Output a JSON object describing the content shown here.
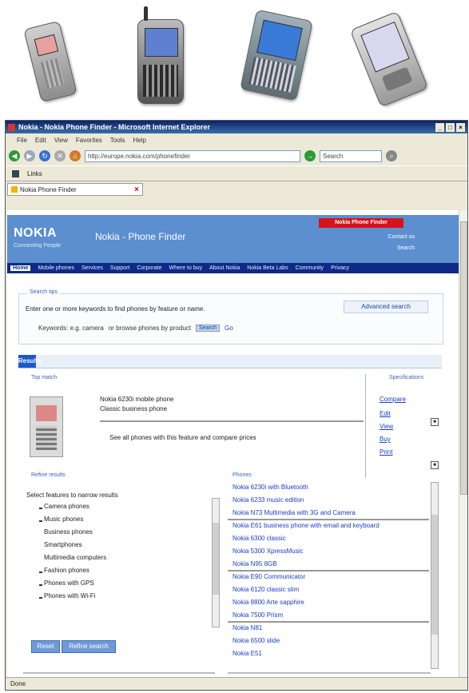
{
  "window": {
    "title": "Nokia - Nokia Phone Finder - Microsoft Internet Explorer",
    "menu": [
      "File",
      "Edit",
      "View",
      "Favorites",
      "Tools",
      "Help"
    ],
    "address": "http://europe.nokia.com/phonefinder",
    "search_placeholder": "Search",
    "links_label": "Links",
    "tab_title": "Nokia Phone Finder",
    "status": "Done"
  },
  "site": {
    "logo": "NOKIA",
    "tagline": "Connecting People",
    "title": "Nokia - Phone Finder",
    "red_link": "Nokia Phone Finder",
    "banner_links": [
      "Contact us",
      "Search"
    ],
    "nav": [
      "Home",
      "Mobile phones",
      "Services",
      "Support",
      "Corporate",
      "Where to buy",
      "About Nokia",
      "Nokia Beta Labs",
      "Community",
      "Privacy"
    ]
  },
  "search_panel": {
    "legend": "Search tips",
    "hint": "Enter one or more keywords to find phones by feature or name.",
    "advanced": "Advanced search",
    "query_label": "Keywords: e.g. camera",
    "query_hint": "or browse phones by product",
    "go": "Search",
    "go2": "Go"
  },
  "results": {
    "tab": "Results",
    "left_title": "Top match",
    "right_title": "Specifications",
    "item_line1": "Nokia 6230i mobile phone",
    "item_line2": "Classic business phone",
    "item_line3": "See all phones with this feature and compare prices",
    "spec_links": [
      "Compare",
      "Edit",
      "View",
      "Buy",
      "Print"
    ]
  },
  "filters": {
    "title": "Refine results",
    "header": "Select features to narrow results",
    "items": [
      "Camera phones",
      "Music phones",
      "Business phones",
      "Smartphones",
      "Multimedia computers",
      "Fashion phones",
      "Phones with GPS",
      "Phones with Wi-Fi"
    ],
    "buttons": [
      "Reset",
      "Refine search"
    ]
  },
  "right_list": {
    "title": "Phones",
    "items": [
      "Nokia 6230i with Bluetooth",
      "Nokia 6233 music edition",
      "Nokia N73 Multimedia with 3G and Camera",
      "Nokia E61 business phone with email and keyboard",
      "Nokia 6300 classic",
      "Nokia 5300 XpressMusic",
      "Nokia N95 8GB",
      "Nokia E90 Communicator",
      "Nokia 6120 classic slim",
      "Nokia 8800 Arte sapphire",
      "Nokia 7500 Prism",
      "Nokia N81",
      "Nokia 6500 slide",
      "Nokia E51"
    ]
  }
}
